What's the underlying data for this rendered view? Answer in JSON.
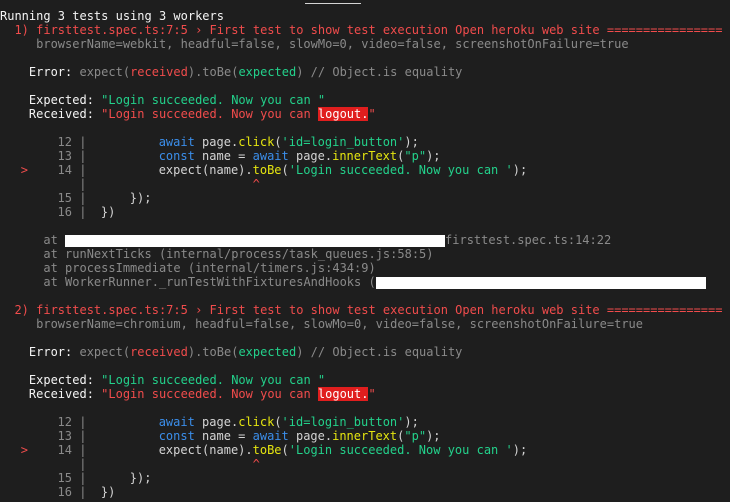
{
  "header": "Running 3 tests using 3 workers",
  "failures": [
    {
      "title": "  1) firsttest.spec.ts:7:5 › First test to show test execution Open heroku web site ================",
      "params": "     browserName=webkit, headful=false, slowMo=0, video=false, screenshotOnFailure=true",
      "error_prefix": "    Error: ",
      "error_expect": "expect(",
      "error_received": "received",
      "error_mid": ").toBe(",
      "error_expected": "expected",
      "error_suffix": ") // Object.is equality",
      "expected_label": "    Expected: ",
      "expected_value": "\"Login succeeded. Now you can \"",
      "received_label": "    Received: ",
      "received_value_pre": "\"Login succeeded. Now you can ",
      "received_value_hl": "logout.",
      "received_value_post": "\"",
      "code": [
        {
          "marker": "",
          "num": "12",
          "text": "          await page.click('id=login_button');"
        },
        {
          "marker": "",
          "num": "13",
          "text": "          const name = await page.innerText(\"p\");"
        },
        {
          "marker": ">",
          "num": "14",
          "text": "          expect(name).toBe('Login succeeded. Now you can ');"
        },
        {
          "marker": "",
          "num": "",
          "text": "                       ^"
        },
        {
          "marker": "",
          "num": "15",
          "text": "      });"
        },
        {
          "marker": "",
          "num": "16",
          "text": "  })"
        }
      ],
      "stack": [
        {
          "prefix": "      at ",
          "text": "firsttest.spec.ts:14:22"
        },
        {
          "prefix": "      at ",
          "text": "runNextTicks (internal/process/task_queues.js:58:5)"
        },
        {
          "prefix": "      at ",
          "text": "processImmediate (internal/timers.js:434:9)"
        },
        {
          "prefix": "      at ",
          "text": "WorkerRunner._runTestWithFixturesAndHooks ("
        }
      ]
    },
    {
      "title": "  2) firsttest.spec.ts:7:5 › First test to show test execution Open heroku web site ================",
      "params": "     browserName=chromium, headful=false, slowMo=0, video=false, screenshotOnFailure=true",
      "error_prefix": "    Error: ",
      "error_expect": "expect(",
      "error_received": "received",
      "error_mid": ").toBe(",
      "error_expected": "expected",
      "error_suffix": ") // Object.is equality",
      "expected_label": "    Expected: ",
      "expected_value": "\"Login succeeded. Now you can \"",
      "received_label": "    Received: ",
      "received_value_pre": "\"Login succeeded. Now you can ",
      "received_value_hl": "logout.",
      "received_value_post": "\"",
      "code": [
        {
          "marker": "",
          "num": "12",
          "text": "          await page.click('id=login_button');"
        },
        {
          "marker": "",
          "num": "13",
          "text": "          const name = await page.innerText(\"p\");"
        },
        {
          "marker": ">",
          "num": "14",
          "text": "          expect(name).toBe('Login succeeded. Now you can ');"
        },
        {
          "marker": "",
          "num": "",
          "text": "                       ^"
        },
        {
          "marker": "",
          "num": "15",
          "text": "      });"
        },
        {
          "marker": "",
          "num": "16",
          "text": "  })"
        }
      ]
    }
  ]
}
